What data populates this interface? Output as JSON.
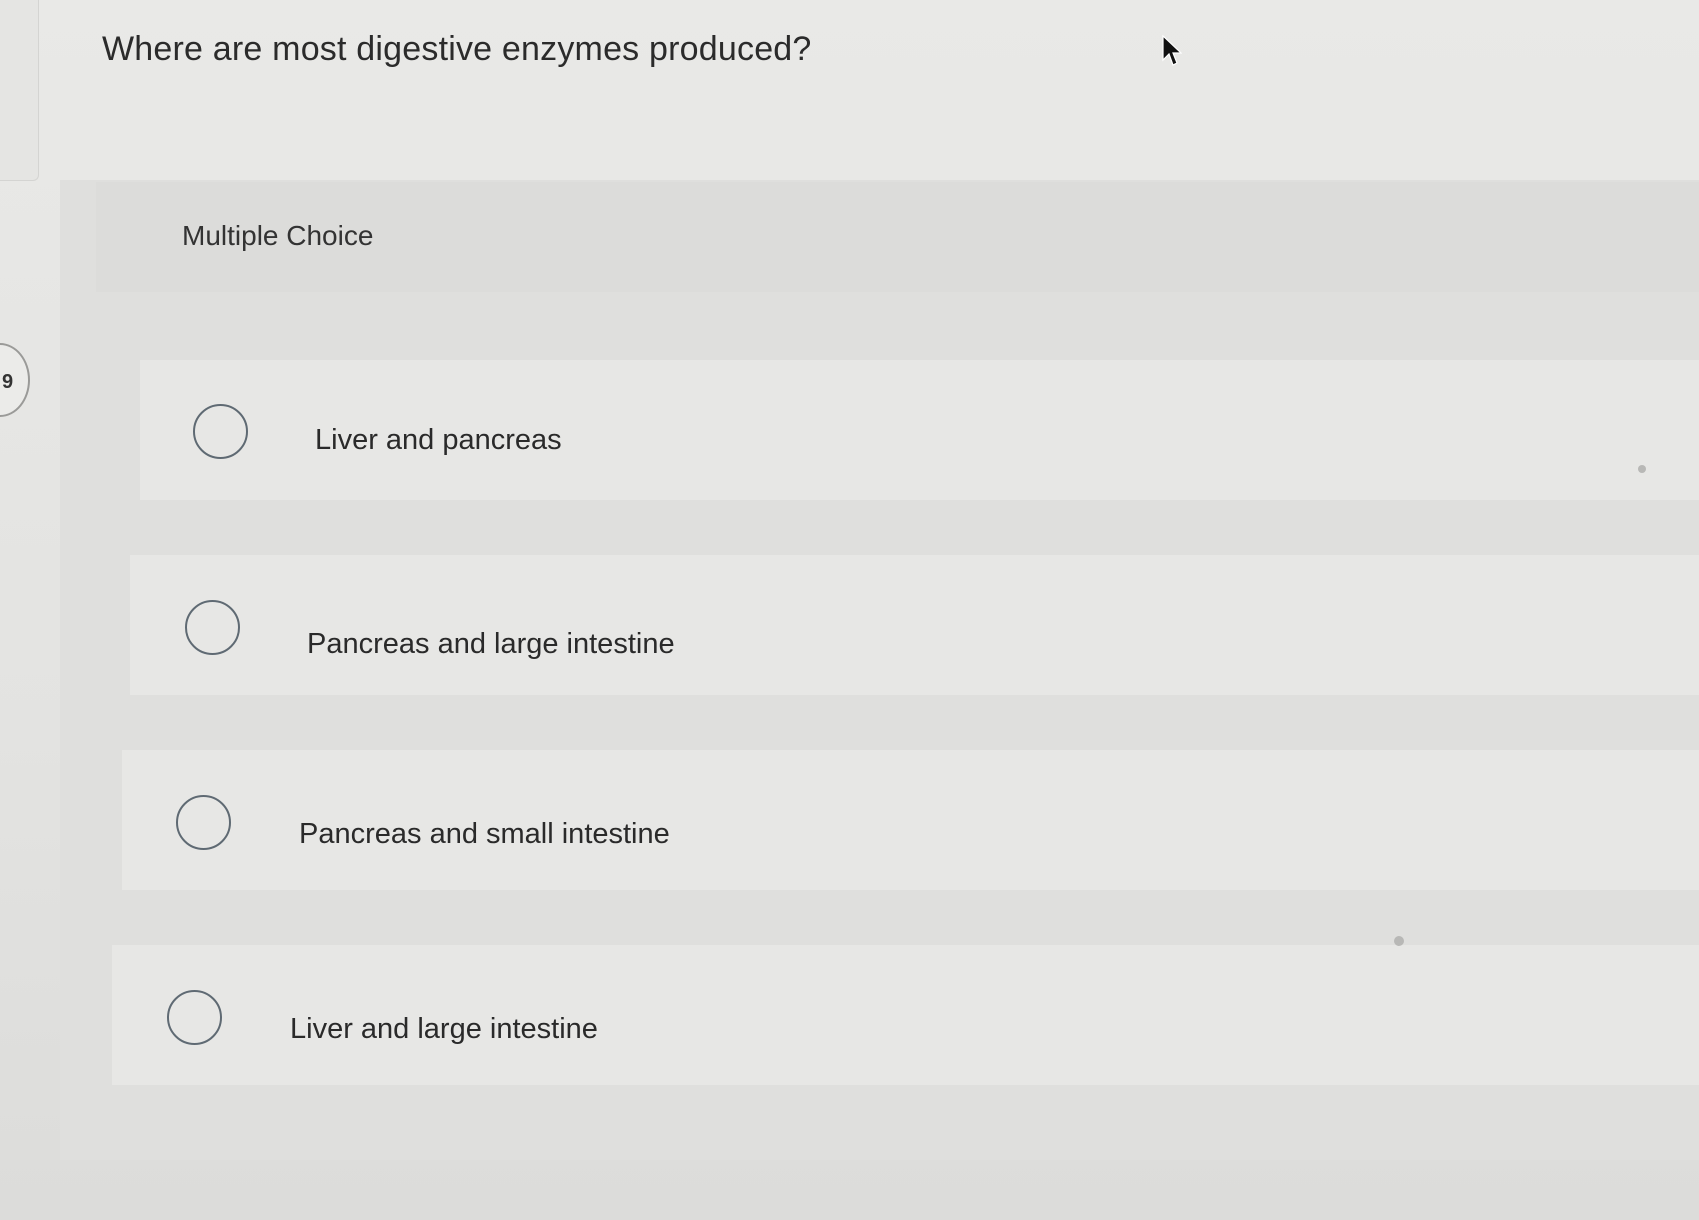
{
  "question": {
    "number": "9",
    "text": "Where are most digestive enzymes produced?"
  },
  "answer_block": {
    "type_label": "Multiple Choice",
    "options": [
      {
        "label": "Liver and pancreas"
      },
      {
        "label": "Pancreas and large intestine"
      },
      {
        "label": "Pancreas and small intestine"
      },
      {
        "label": "Liver and large intestine"
      }
    ]
  },
  "colors": {
    "radio_border": "#5f6a73",
    "background": "#e6e6e4"
  },
  "icons": {
    "cursor": "mouse-pointer-icon",
    "radio": "radio-button-empty"
  }
}
